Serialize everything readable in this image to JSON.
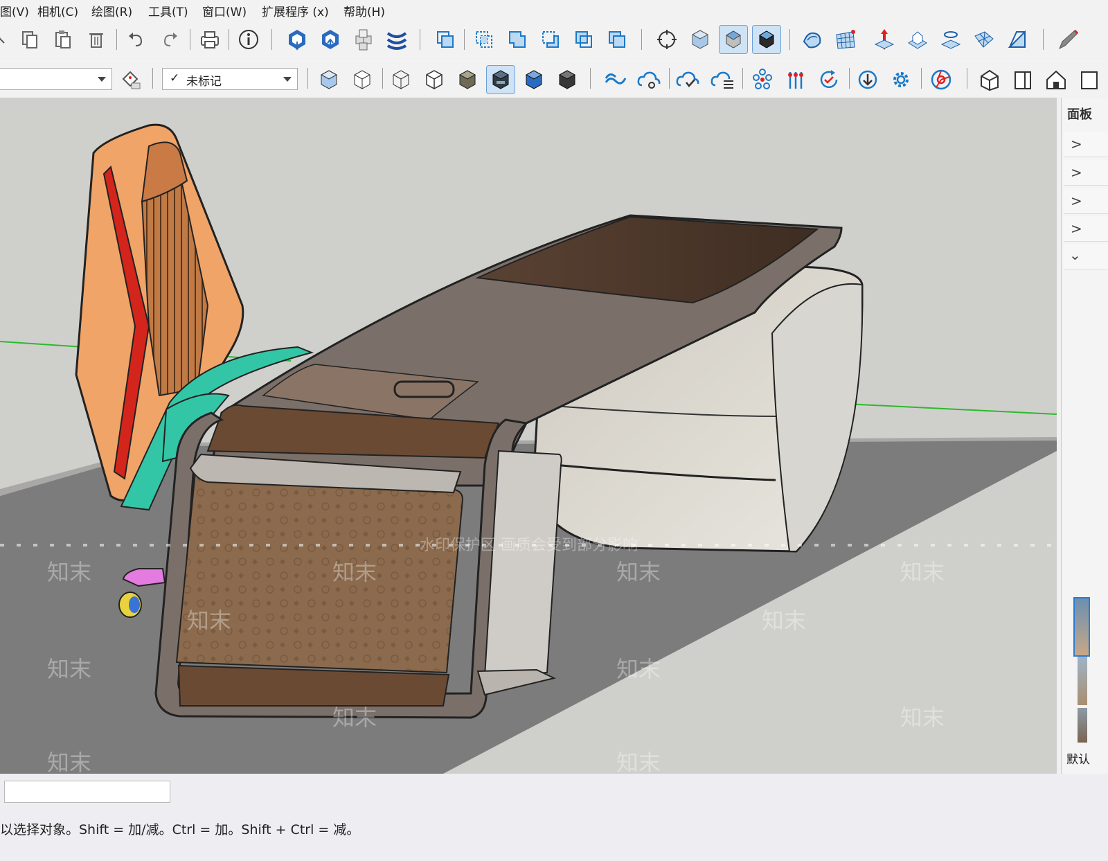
{
  "menu": {
    "items": [
      "图(V)",
      "相机(C)",
      "绘图(R)",
      "工具(T)",
      "窗口(W)",
      "扩展程序 (x)",
      "帮助(H)"
    ]
  },
  "toolbar": {
    "layer_combo_value": "",
    "tag_combo_value": "未标记",
    "tag_combo_check": "✓"
  },
  "right_panel": {
    "title": "面板",
    "bottom_label": "默认"
  },
  "viewport": {
    "watermark_brand": "知末",
    "watermark_notice": "水印保护区  画质会受到部分影响"
  },
  "statusbar": {
    "measure_value": "",
    "hint_text": "以选择对象。Shift = 加/减。Ctrl = 加。Shift + Ctrl = 减。"
  },
  "colors": {
    "viewport_bg": "#cfd0cb",
    "floor": "#7d7c7c",
    "desk_top": "#4e3a2c",
    "desk_frame": "#7a7069",
    "chair_back": "#f0a468",
    "chair_accent": "#d3251c",
    "chair_base": "#32c6a6",
    "active_button": "#cfe3f7"
  }
}
